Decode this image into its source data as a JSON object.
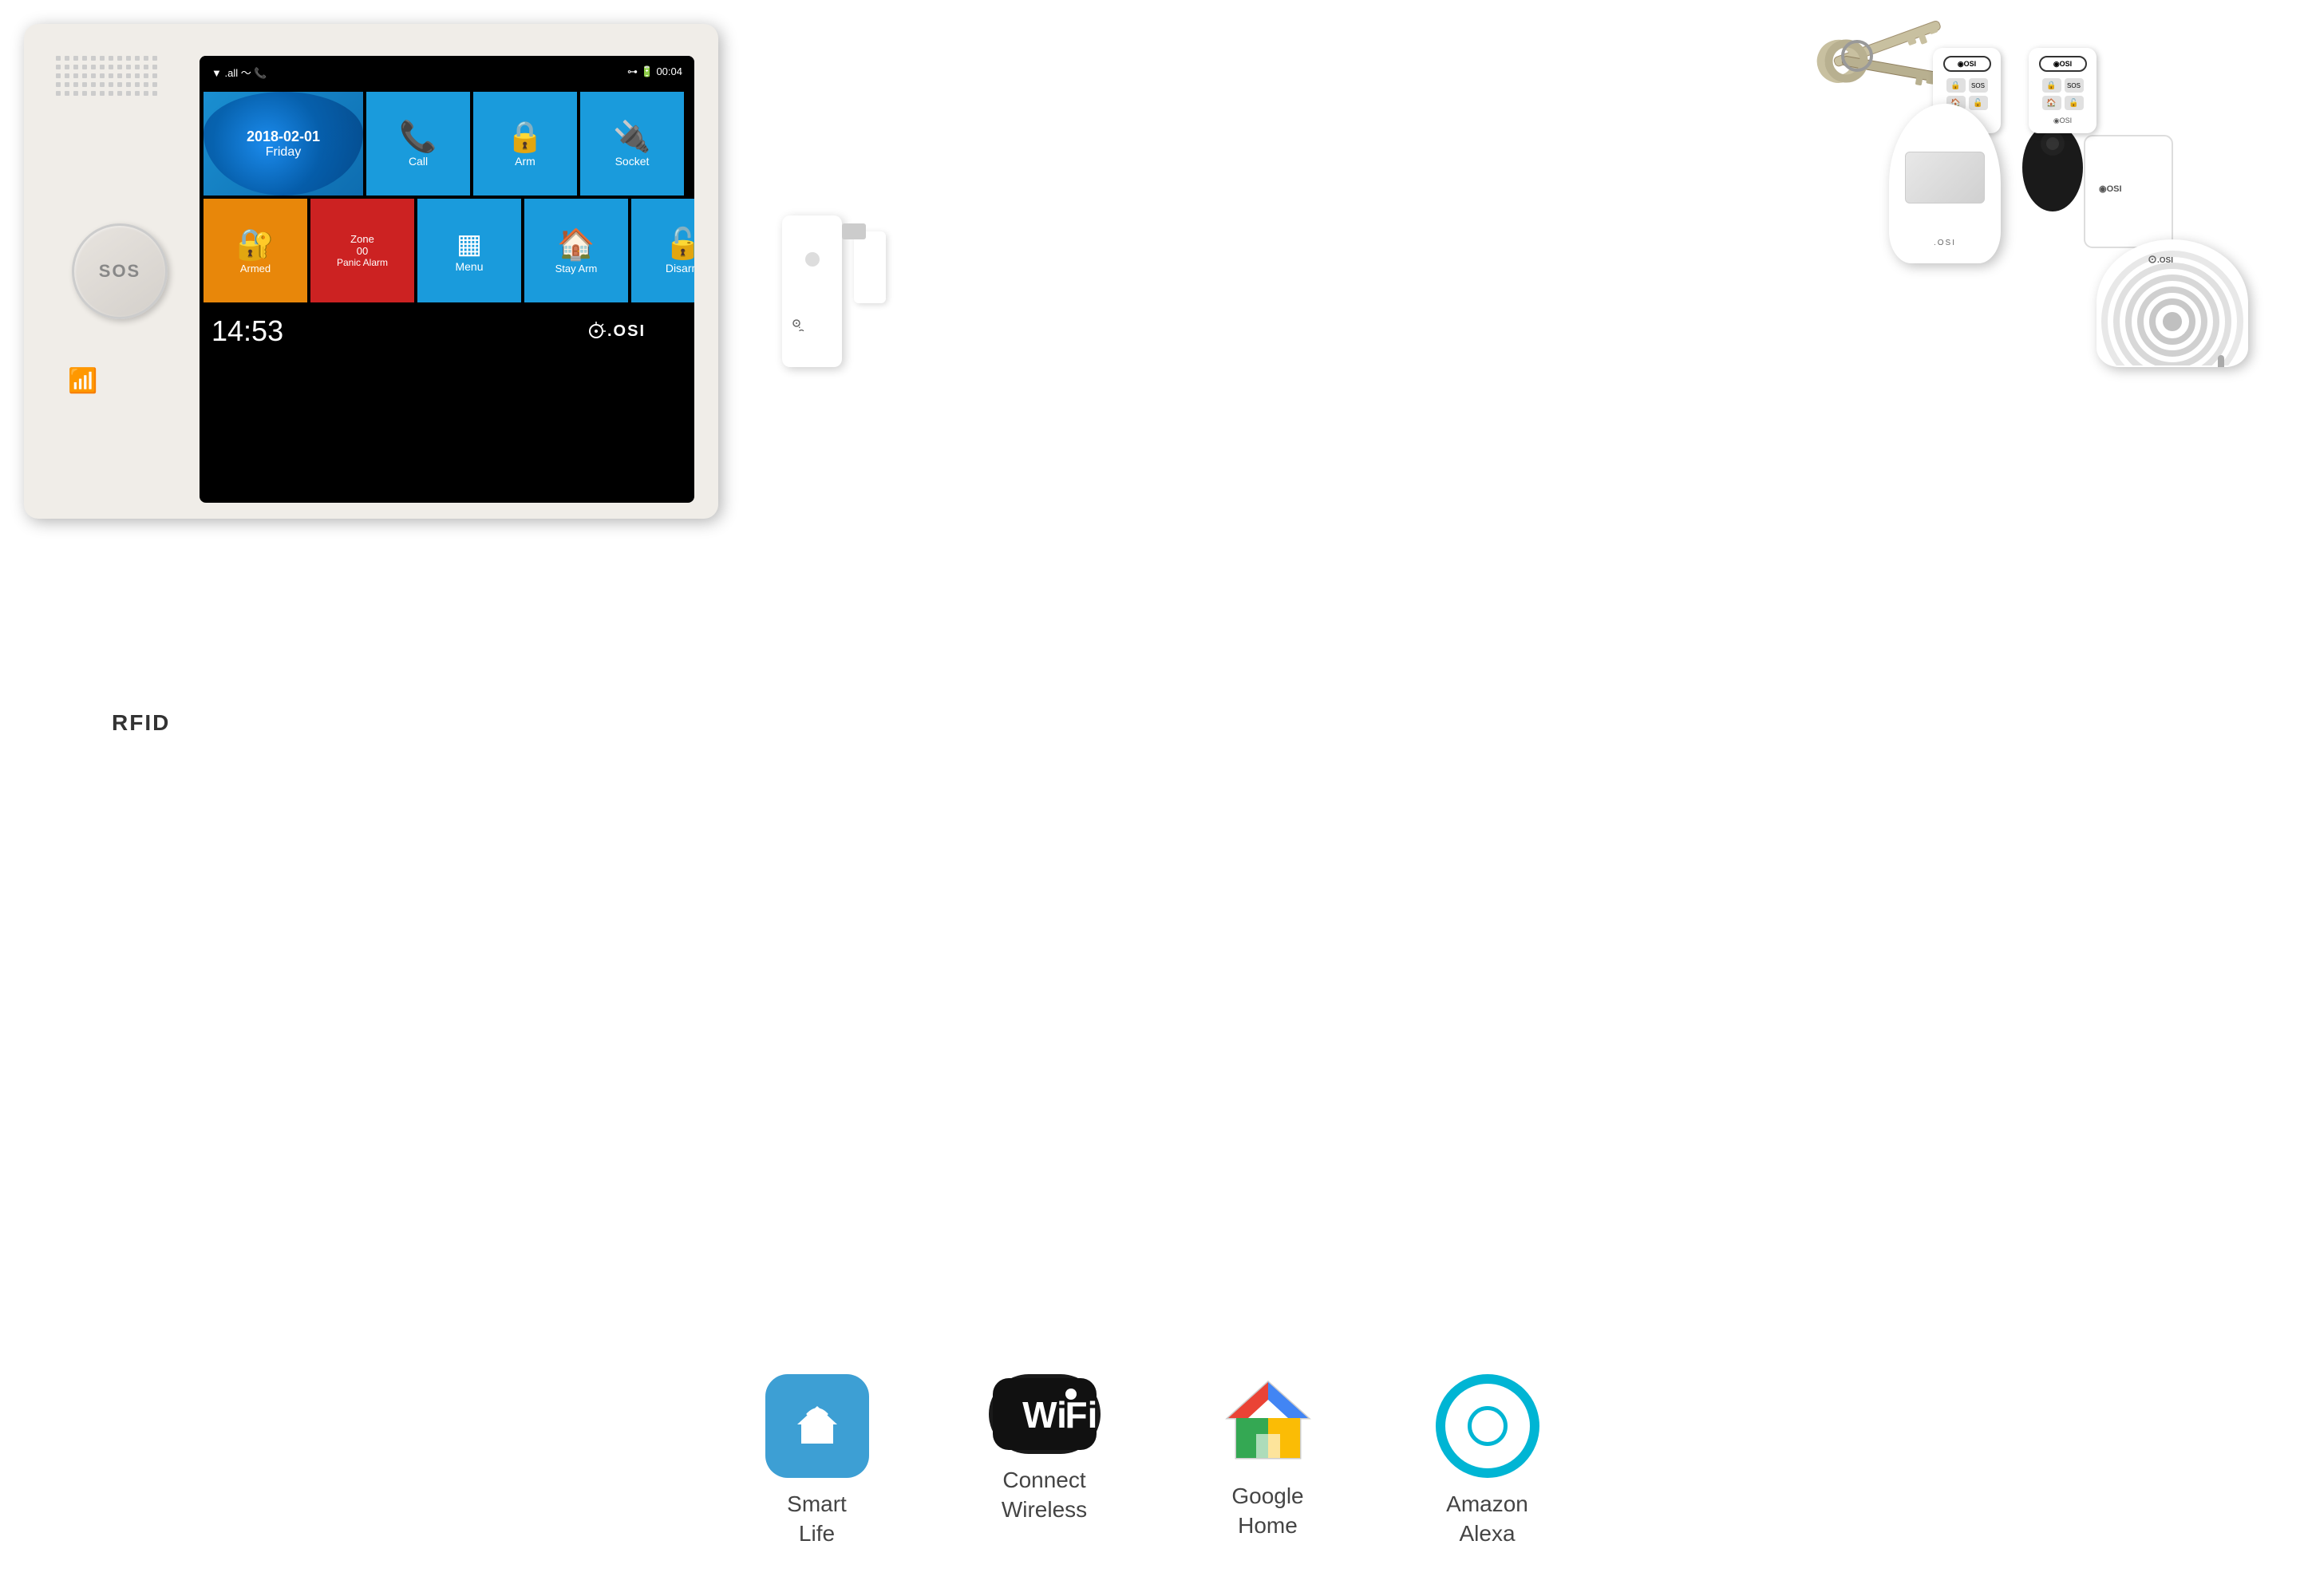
{
  "panel": {
    "sos_label": "SOS",
    "rfid_label": "RFID",
    "brand": ".OSI"
  },
  "screen": {
    "status_bar": {
      "signal": "▼.all",
      "wifi": "WiFi",
      "phone": "📞",
      "key": "🔑",
      "battery": "🔋",
      "time": "00:04"
    },
    "date": "2018-02-01",
    "day": "Friday",
    "tiles": [
      {
        "label": "Call",
        "icon": "📞"
      },
      {
        "label": "Arm",
        "icon": "🔒"
      },
      {
        "label": "Socket",
        "icon": "⚙"
      },
      {
        "label": "Armed",
        "icon": "🔐"
      },
      {
        "label": "Panic Alarm",
        "zone": "Zone 00"
      },
      {
        "label": "Menu",
        "icon": "☰"
      },
      {
        "label": "Stay Arm",
        "icon": "🏠"
      },
      {
        "label": "Disarm",
        "icon": "🔓"
      }
    ],
    "clock": "14:53"
  },
  "keys": {
    "description": "Metal keys on keyring"
  },
  "rfid_tags": {
    "description": "Black RFID fob and white card"
  },
  "remotes": [
    {
      "label": ".OSI",
      "buttons": [
        "🔒",
        "SOS",
        "🏠",
        "🔓"
      ]
    },
    {
      "label": ".OSI",
      "buttons": [
        "🔒",
        "SOS",
        "🏠",
        "🔓"
      ]
    }
  ],
  "pir_sensor": {
    "brand": ".OSI",
    "description": "PIR Motion Detector"
  },
  "door_sensor": {
    "brand": ".OSI",
    "description": "Door/Window Contact Sensor"
  },
  "siren": {
    "brand": ".OSI",
    "description": "Indoor Siren"
  },
  "bottom_apps": [
    {
      "name": "Smart Life",
      "label": "Smart\nLife",
      "label_line1": "Smart",
      "label_line2": "Life",
      "type": "smart_life"
    },
    {
      "name": "Connect Wireless",
      "label_line1": "Connect",
      "label_line2": "Wireless",
      "type": "wifi"
    },
    {
      "name": "Google Home",
      "label_line1": "Google",
      "label_line2": "Home",
      "type": "google_home"
    },
    {
      "name": "Amazon Alexa",
      "label_line1": "Amazon",
      "label_line2": "Alexa",
      "type": "alexa"
    }
  ]
}
